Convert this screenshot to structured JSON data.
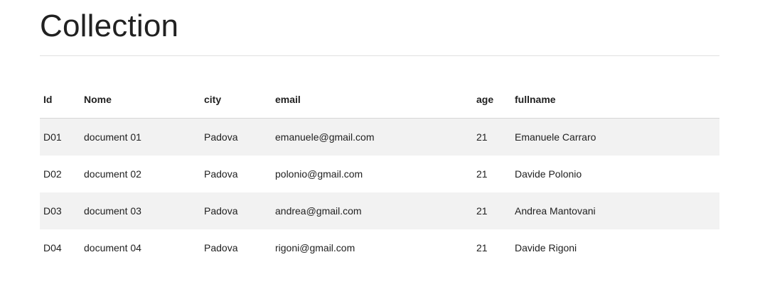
{
  "page": {
    "title": "Collection"
  },
  "table": {
    "headers": {
      "id": "Id",
      "nome": "Nome",
      "city": "city",
      "email": "email",
      "age": "age",
      "fullname": "fullname"
    },
    "rows": [
      {
        "id": "D01",
        "nome": "document 01",
        "city": "Padova",
        "email": "emanuele@gmail.com",
        "age": "21",
        "fullname": "Emanuele Carraro"
      },
      {
        "id": "D02",
        "nome": "document 02",
        "city": "Padova",
        "email": "polonio@gmail.com",
        "age": "21",
        "fullname": "Davide Polonio"
      },
      {
        "id": "D03",
        "nome": "document 03",
        "city": "Padova",
        "email": "andrea@gmail.com",
        "age": "21",
        "fullname": "Andrea Mantovani"
      },
      {
        "id": "D04",
        "nome": "document 04",
        "city": "Padova",
        "email": "rigoni@gmail.com",
        "age": "21",
        "fullname": "Davide Rigoni"
      }
    ]
  },
  "colors": {
    "text": "#212121",
    "stripe": "#f2f2f2",
    "divider": "#e0e0e0"
  }
}
